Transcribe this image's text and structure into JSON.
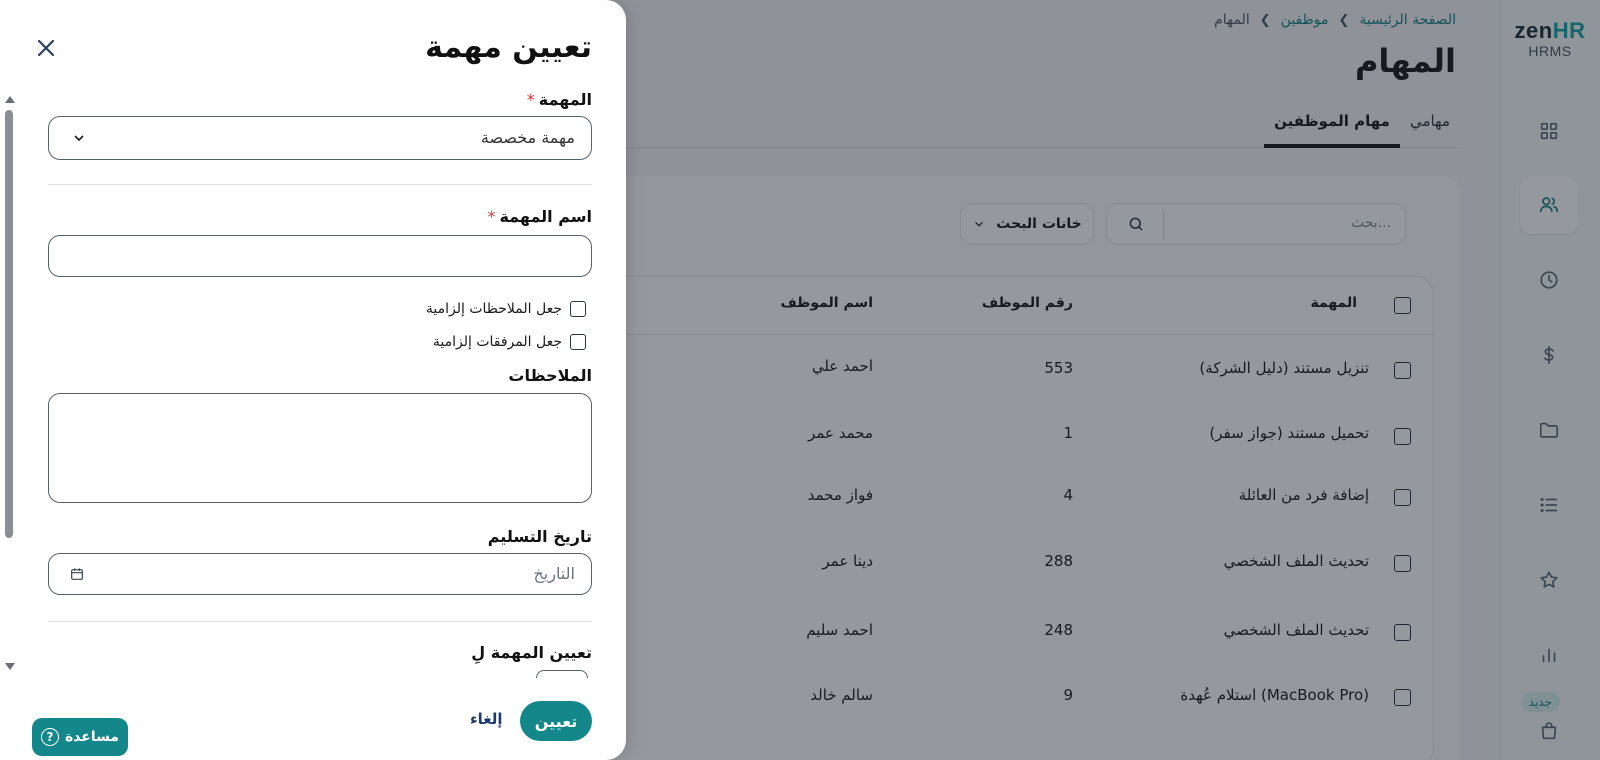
{
  "brand": {
    "logo_main_a": "zen",
    "logo_main_b": "HR",
    "logo_sub": "HRMS",
    "accent": "#14878b"
  },
  "sidebar": {
    "icons": [
      "grid-icon",
      "users-icon",
      "clock-icon",
      "dollar-icon",
      "folder-icon",
      "list-icon",
      "star-icon",
      "chart-icon",
      "bag-icon"
    ],
    "new_badge": "جديد"
  },
  "breadcrumb": {
    "home": "الصفحة الرئيسية",
    "employees": "موظفين",
    "current": "المهام"
  },
  "page": {
    "title": "المهام"
  },
  "tabs": [
    {
      "label": "مهامي"
    },
    {
      "label": "مهام الموظفين"
    }
  ],
  "search": {
    "placeholder": "بحث..."
  },
  "fields_button": {
    "label": "خانات البحث"
  },
  "table": {
    "headers": {
      "task": "المهمة",
      "employee_number": "رقم الموظف",
      "employee_name": "اسم الموظف"
    },
    "rows": [
      {
        "task": "تنزيل مستند (دليل الشركة)",
        "number": "553",
        "name": "احمد علي"
      },
      {
        "task": "تحميل مستند (جواز سفر)",
        "number": "1",
        "name": "محمد عمر"
      },
      {
        "task": "إضافة فرد من العائلة",
        "number": "4",
        "name": "فواز محمد"
      },
      {
        "task": "تحديث الملف الشخصي",
        "number": "288",
        "name": "دينا عمر"
      },
      {
        "task": "تحديث الملف الشخصي",
        "number": "248",
        "name": "احمد سليم"
      },
      {
        "task": "استلام عُهدة (MacBook Pro)",
        "number": "9",
        "name": "سالم خالد"
      }
    ]
  },
  "drawer": {
    "title": "تعيين مهمة",
    "task_label": "المهمة",
    "task_value": "مهمة مخصصة",
    "required_mark": "*",
    "task_name_label": "اسم المهمة",
    "task_name_value": "",
    "notes_required_label": "جعل الملاحظات إلزامية",
    "attachments_required_label": "جعل المرفقات إلزامية",
    "notes_label": "الملاحظات",
    "notes_value": "",
    "due_date_label": "تاريخ التسليم",
    "due_date_placeholder": "التاريخ",
    "assign_to_label": "تعيين المهمة لِ",
    "assign_button": "تعيين",
    "cancel_button": "إلغاء"
  },
  "help": {
    "label": "مساعدة",
    "icon_glyph": "?"
  }
}
